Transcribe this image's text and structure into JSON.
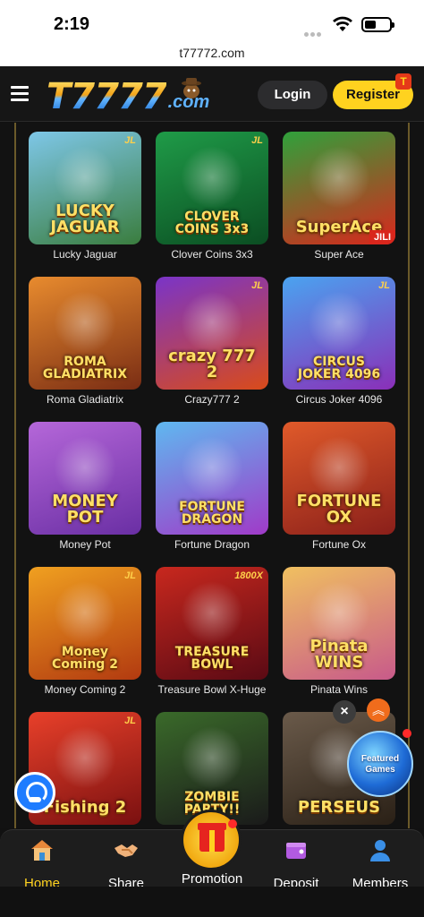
{
  "status_bar": {
    "time": "2:19"
  },
  "browser": {
    "url": "t77772.com"
  },
  "header": {
    "logo_main": "T7777",
    "logo_domain": ".com",
    "login_label": "Login",
    "register_label": "Register",
    "register_badge": "T"
  },
  "games": [
    {
      "name": "Lucky Jaguar",
      "art": "LUCKY JAGUAR",
      "badge": "JL",
      "bg": [
        "#7ec7e8",
        "#3a7d3e"
      ]
    },
    {
      "name": "Clover Coins 3x3",
      "art": "CLOVER COINS 3x3",
      "badge": "JL",
      "bg": [
        "#1f9b48",
        "#0b4d22"
      ]
    },
    {
      "name": "Super Ace",
      "art": "SuperAce",
      "badge": "JILI",
      "bg": [
        "#2fa13b",
        "#d9261c"
      ]
    },
    {
      "name": "Roma Gladiatrix",
      "art": "ROMA GLADIATRIX",
      "badge": "",
      "bg": [
        "#e88b2e",
        "#7a2d14"
      ]
    },
    {
      "name": "Crazy777 2",
      "art": "crazy 777 2",
      "badge": "JL",
      "bg": [
        "#7a34c8",
        "#d94b1a"
      ]
    },
    {
      "name": "Circus Joker 4096",
      "art": "CIRCUS JOKER 4096",
      "badge": "JL",
      "bg": [
        "#4aa3f0",
        "#8a2fb8"
      ]
    },
    {
      "name": "Money Pot",
      "art": "MONEY POT",
      "badge": "",
      "bg": [
        "#b567d9",
        "#6a2fa4"
      ]
    },
    {
      "name": "Fortune Dragon",
      "art": "FORTUNE DRAGON",
      "badge": "",
      "bg": [
        "#5fb8f0",
        "#a03ac8"
      ]
    },
    {
      "name": "Fortune Ox",
      "art": "FORTUNE OX",
      "badge": "",
      "bg": [
        "#e05a2a",
        "#8a1f1a"
      ]
    },
    {
      "name": "Money Coming 2",
      "art": "Money Coming 2",
      "badge": "JL",
      "bg": [
        "#f0a020",
        "#b23a10"
      ]
    },
    {
      "name": "Treasure Bowl X-Huge",
      "art": "TREASURE BOWL",
      "badge": "1800X",
      "bg": [
        "#c8281e",
        "#5a0a14"
      ]
    },
    {
      "name": "Pinata Wins",
      "art": "Pinata WINS",
      "badge": "",
      "bg": [
        "#f0c060",
        "#c85a8a"
      ]
    },
    {
      "name": "",
      "art": "Fishing 2",
      "badge": "JL",
      "bg": [
        "#e8402a",
        "#7a1010"
      ]
    },
    {
      "name": "",
      "art": "ZOMBIE PARTY!!",
      "badge": "",
      "bg": [
        "#3a6a2a",
        "#1a1a1a"
      ]
    },
    {
      "name": "",
      "art": "PERSEUS",
      "badge": "",
      "bg": [
        "#6a5a4a",
        "#2a2016"
      ]
    }
  ],
  "floating": {
    "close_label": "×",
    "featured_label": "Featured Games",
    "scroll_top_label": "︽"
  },
  "bottom_nav": [
    {
      "label": "Home",
      "icon": "home-icon"
    },
    {
      "label": "Share",
      "icon": "handshake-icon"
    },
    {
      "label": "Promotion",
      "icon": "gift-icon"
    },
    {
      "label": "Deposit",
      "icon": "wallet-icon"
    },
    {
      "label": "Members",
      "icon": "person-icon"
    }
  ],
  "colors": {
    "accent": "#ffd21f",
    "background": "#121212",
    "nav_active": "#ffd21f"
  }
}
